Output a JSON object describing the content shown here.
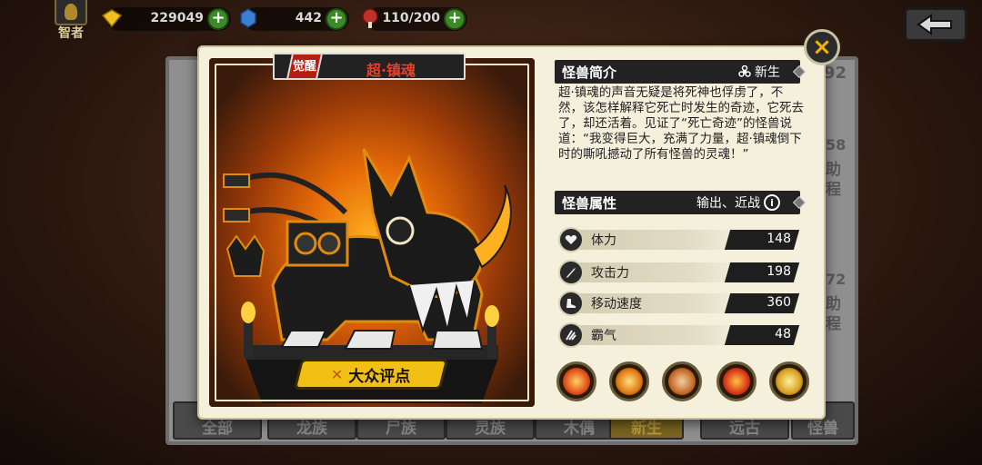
{
  "hud": {
    "rank_label": "智者",
    "coins": "229049",
    "gems": "442",
    "stamina": "110/200",
    "plus_label": "+"
  },
  "background": {
    "right_ghost_numbers": [
      "92",
      "58",
      "72"
    ],
    "right_ghost_text": [
      "助",
      "程",
      "助",
      "程"
    ],
    "tabs": [
      {
        "label": "全部",
        "active": false
      },
      {
        "label": "龙族",
        "active": false
      },
      {
        "label": "尸族",
        "active": false
      },
      {
        "label": "灵族",
        "active": false
      },
      {
        "label": "木偶",
        "active": false
      },
      {
        "label": "新生",
        "active": true
      },
      {
        "label": "远古",
        "active": false
      },
      {
        "label": "怪兽",
        "active": false
      }
    ]
  },
  "monster": {
    "name": "超·镇魂",
    "awaken_badge": "觉醒",
    "rate_button": "大众评点"
  },
  "intro": {
    "header": "怪兽简介",
    "category": "新生",
    "description": "超·镇魂的声音无疑是将死神也俘虏了，不然，该怎样解释它死亡时发生的奇迹，它死去了，却还活着。见证了“死亡奇迹”的怪兽说道：“我变得巨大，充满了力量，超·镇魂倒下时的嘶吼撼动了所有怪兽的灵魂！”"
  },
  "attributes": {
    "header": "怪兽属性",
    "tags": "输出、近战",
    "info_label": "i",
    "stats": [
      {
        "label": "体力",
        "value": "148",
        "icon": "heart-icon"
      },
      {
        "label": "攻击力",
        "value": "198",
        "icon": "sword-icon"
      },
      {
        "label": "移动速度",
        "value": "360",
        "icon": "boot-icon"
      },
      {
        "label": "霸气",
        "value": "48",
        "icon": "claw-icon"
      }
    ]
  },
  "skills": [
    {
      "icon": "fire-swirl-icon",
      "color": "#e0501a"
    },
    {
      "icon": "flame-burst-icon",
      "color": "#e07a12"
    },
    {
      "icon": "beast-head-icon",
      "color": "#c86a2a"
    },
    {
      "icon": "skull-fire-icon",
      "color": "#d8381a"
    },
    {
      "icon": "golden-emblem-icon",
      "color": "#d8a020"
    }
  ],
  "close_label": "×"
}
